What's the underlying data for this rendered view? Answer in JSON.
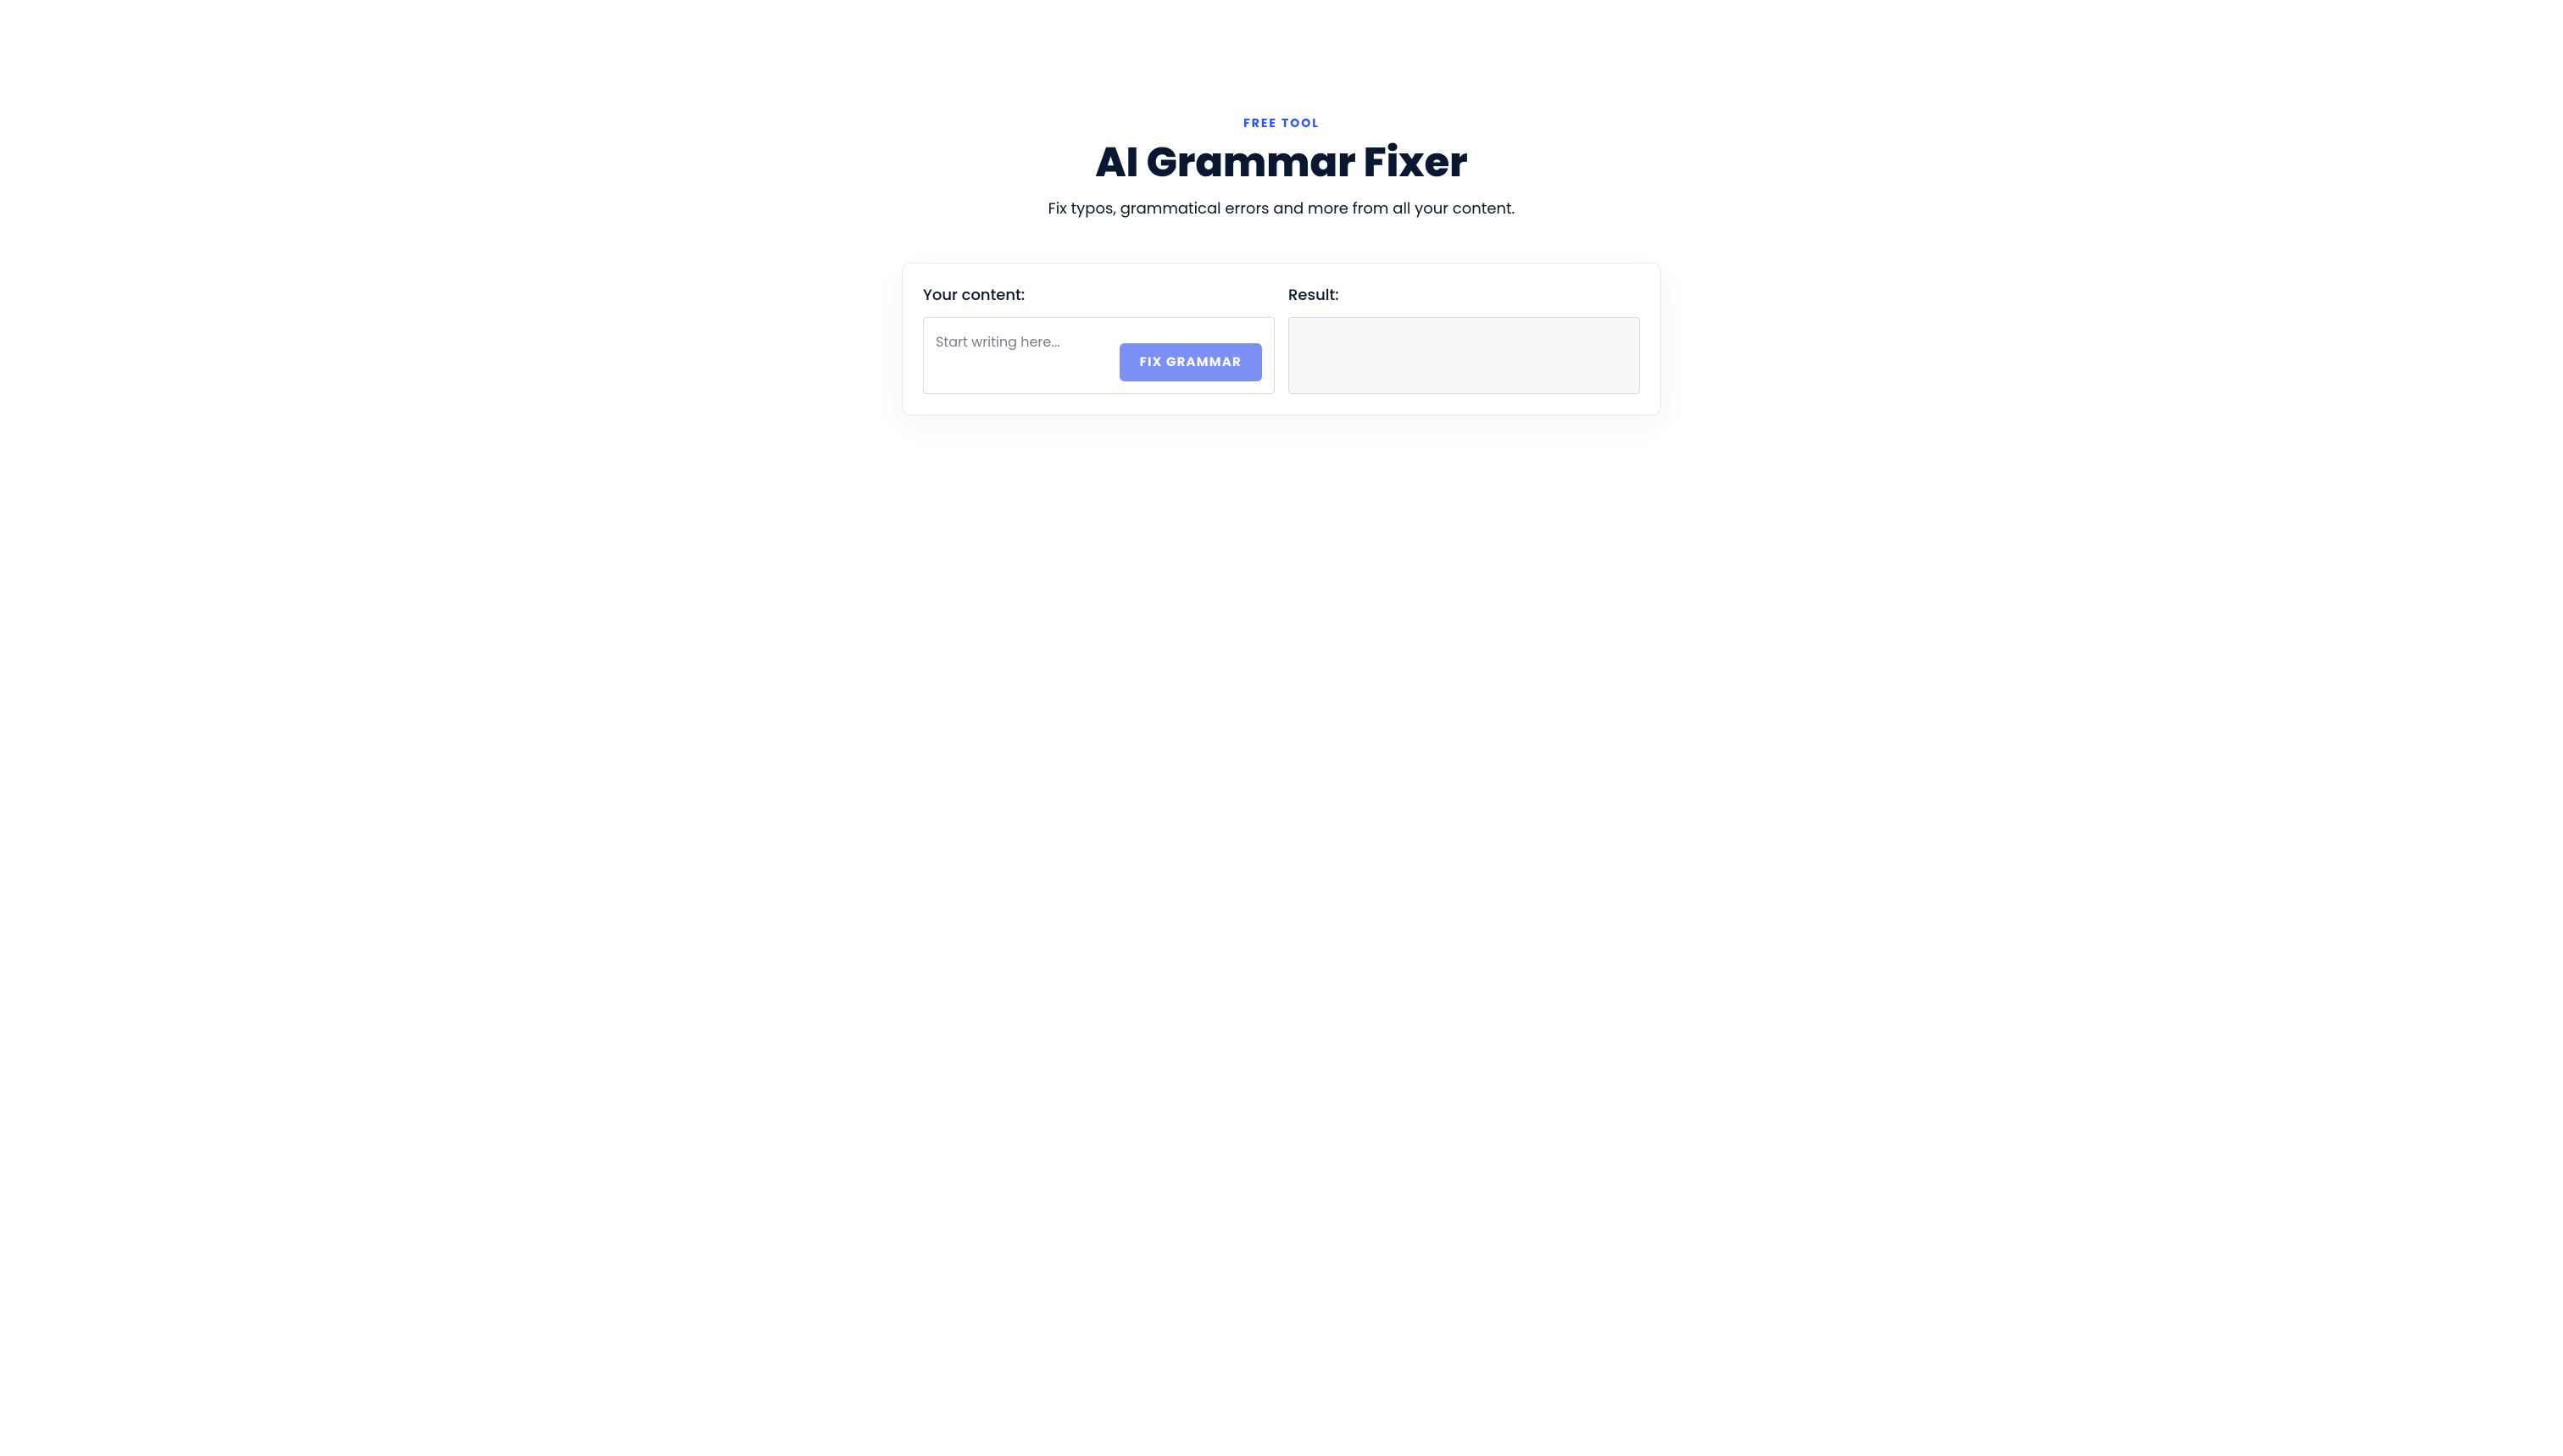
{
  "header": {
    "eyebrow": "FREE TOOL",
    "title": "AI Grammar Fixer",
    "subtitle": "Fix typos, grammatical errors and more from all your content."
  },
  "panels": {
    "input": {
      "label": "Your content:",
      "placeholder": "Start writing here...",
      "value": ""
    },
    "result": {
      "label": "Result:",
      "value": ""
    }
  },
  "actions": {
    "fix_button_label": "FIX GRAMMAR"
  }
}
